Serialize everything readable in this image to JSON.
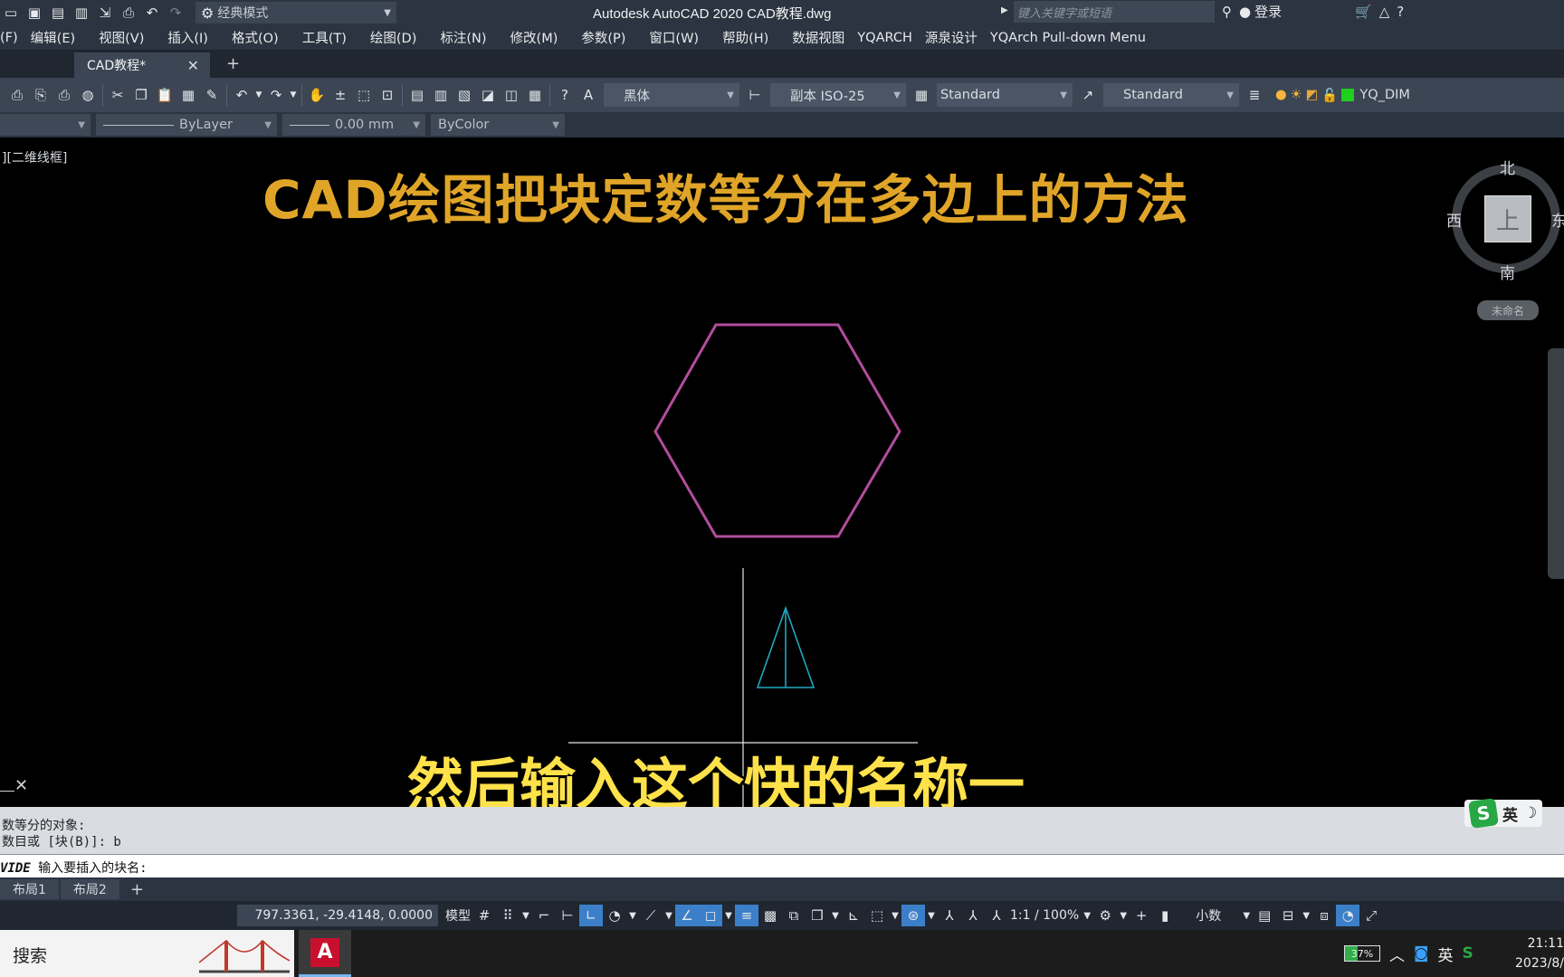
{
  "titlebar": {
    "workspace": "经典模式",
    "app_title": "Autodesk AutoCAD 2020    CAD教程.dwg",
    "search_placeholder": "键入关键字或短语",
    "login": "登录"
  },
  "menu": {
    "items": [
      "(F)",
      "编辑(E)",
      "视图(V)",
      "插入(I)",
      "格式(O)",
      "工具(T)",
      "绘图(D)",
      "标注(N)",
      "修改(M)",
      "参数(P)",
      "窗口(W)",
      "帮助(H)",
      "数据视图",
      "YQARCH",
      "源泉设计",
      "YQArch Pull-down Menu"
    ]
  },
  "tabs": {
    "document": "CAD教程*",
    "close": "✕",
    "add": "+"
  },
  "toolbar": {
    "text_style": "黑体",
    "dim_style": "副本 ISO-25",
    "table_style": "Standard",
    "multileader_style": "Standard",
    "layer": "YQ_DIM"
  },
  "properties": {
    "linetype": "ByLayer",
    "lineweight": "0.00 mm",
    "plotstyle": "ByColor"
  },
  "canvas": {
    "viewport_label": "][二维线框]",
    "headline": "CAD绘图把块定数等分在多边上的方法",
    "subtitle": "然后输入这个快的名称一",
    "colors": {
      "hexagon": "#c8408c",
      "triangle": "#1fa7c0",
      "line": "#ffffff",
      "headline": "#e0a528",
      "subtitle": "#ffe24a"
    }
  },
  "viewcube": {
    "north": "北",
    "south": "南",
    "west": "西",
    "east": "东",
    "face": "上",
    "ucs": "未命名"
  },
  "command": {
    "history_1": "数等分的对象:",
    "history_2": "数目或 [块(B)]: b",
    "prompt_cmd": "VIDE",
    "prompt_text": " 输入要插入的块名:"
  },
  "ime": {
    "lang": "英"
  },
  "layouts": {
    "tab1": "布局1",
    "tab2": "布局2",
    "add": "+"
  },
  "status": {
    "coords": "797.3361, -29.4148, 0.0000",
    "model": "模型",
    "scale": "1:1 / 100%",
    "units": "小数"
  },
  "taskbar": {
    "search": "搜索",
    "app_icon": "A",
    "battery": "37%",
    "battery_level": 0.37,
    "ime": "英",
    "time": "21:11",
    "date": "2023/8/"
  }
}
